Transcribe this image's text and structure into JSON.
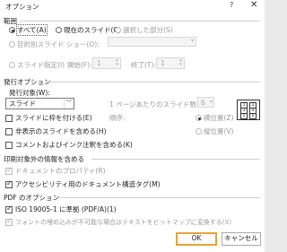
{
  "window": {
    "title": "オプション",
    "help": "?",
    "close": "✕"
  },
  "range": {
    "label": "範囲",
    "all": "すべて(A)",
    "current": "現在のスライド(C)",
    "selection": "選択した部分(S)",
    "custom_show": "目的別スライド ショー(O):",
    "slides": "スライド指定(I)",
    "from_label": "開始(F):",
    "from_value": "1",
    "to_label": "終了(T):",
    "to_value": "1"
  },
  "publish": {
    "label": "発行オプション",
    "target_label": "発行対象(W):",
    "target_value": "スライド",
    "per_page_label": "1 ページあたりのスライド数(L):",
    "per_page_value": "6",
    "frame": "スライドに枠を付ける(E)",
    "hidden": "非表示のスライドを含める(H)",
    "comments": "コメントおよびインク注釈を含める(K)",
    "order_label": "順序:",
    "horizontal": "横位置(Z)",
    "vertical": "縦位置(V)",
    "orient_cells": [
      "1",
      "2",
      "3",
      "4",
      "5",
      "6"
    ]
  },
  "nonprint": {
    "label": "印刷対象外の情報を含める",
    "doc_props": "ドキュメントのプロパティ(R)",
    "tags": "アクセシビリティ用のドキュメント構造タグ(M)"
  },
  "pdf": {
    "label": "PDF のオプション",
    "iso": "ISO 19005-1 に準拠 (PDF/A)(1)",
    "bitmap": "フォントの埋め込みが不可能な場合はテキストをビットマップに変換する(X)"
  },
  "buttons": {
    "ok": "OK",
    "cancel": "キャンセル"
  }
}
